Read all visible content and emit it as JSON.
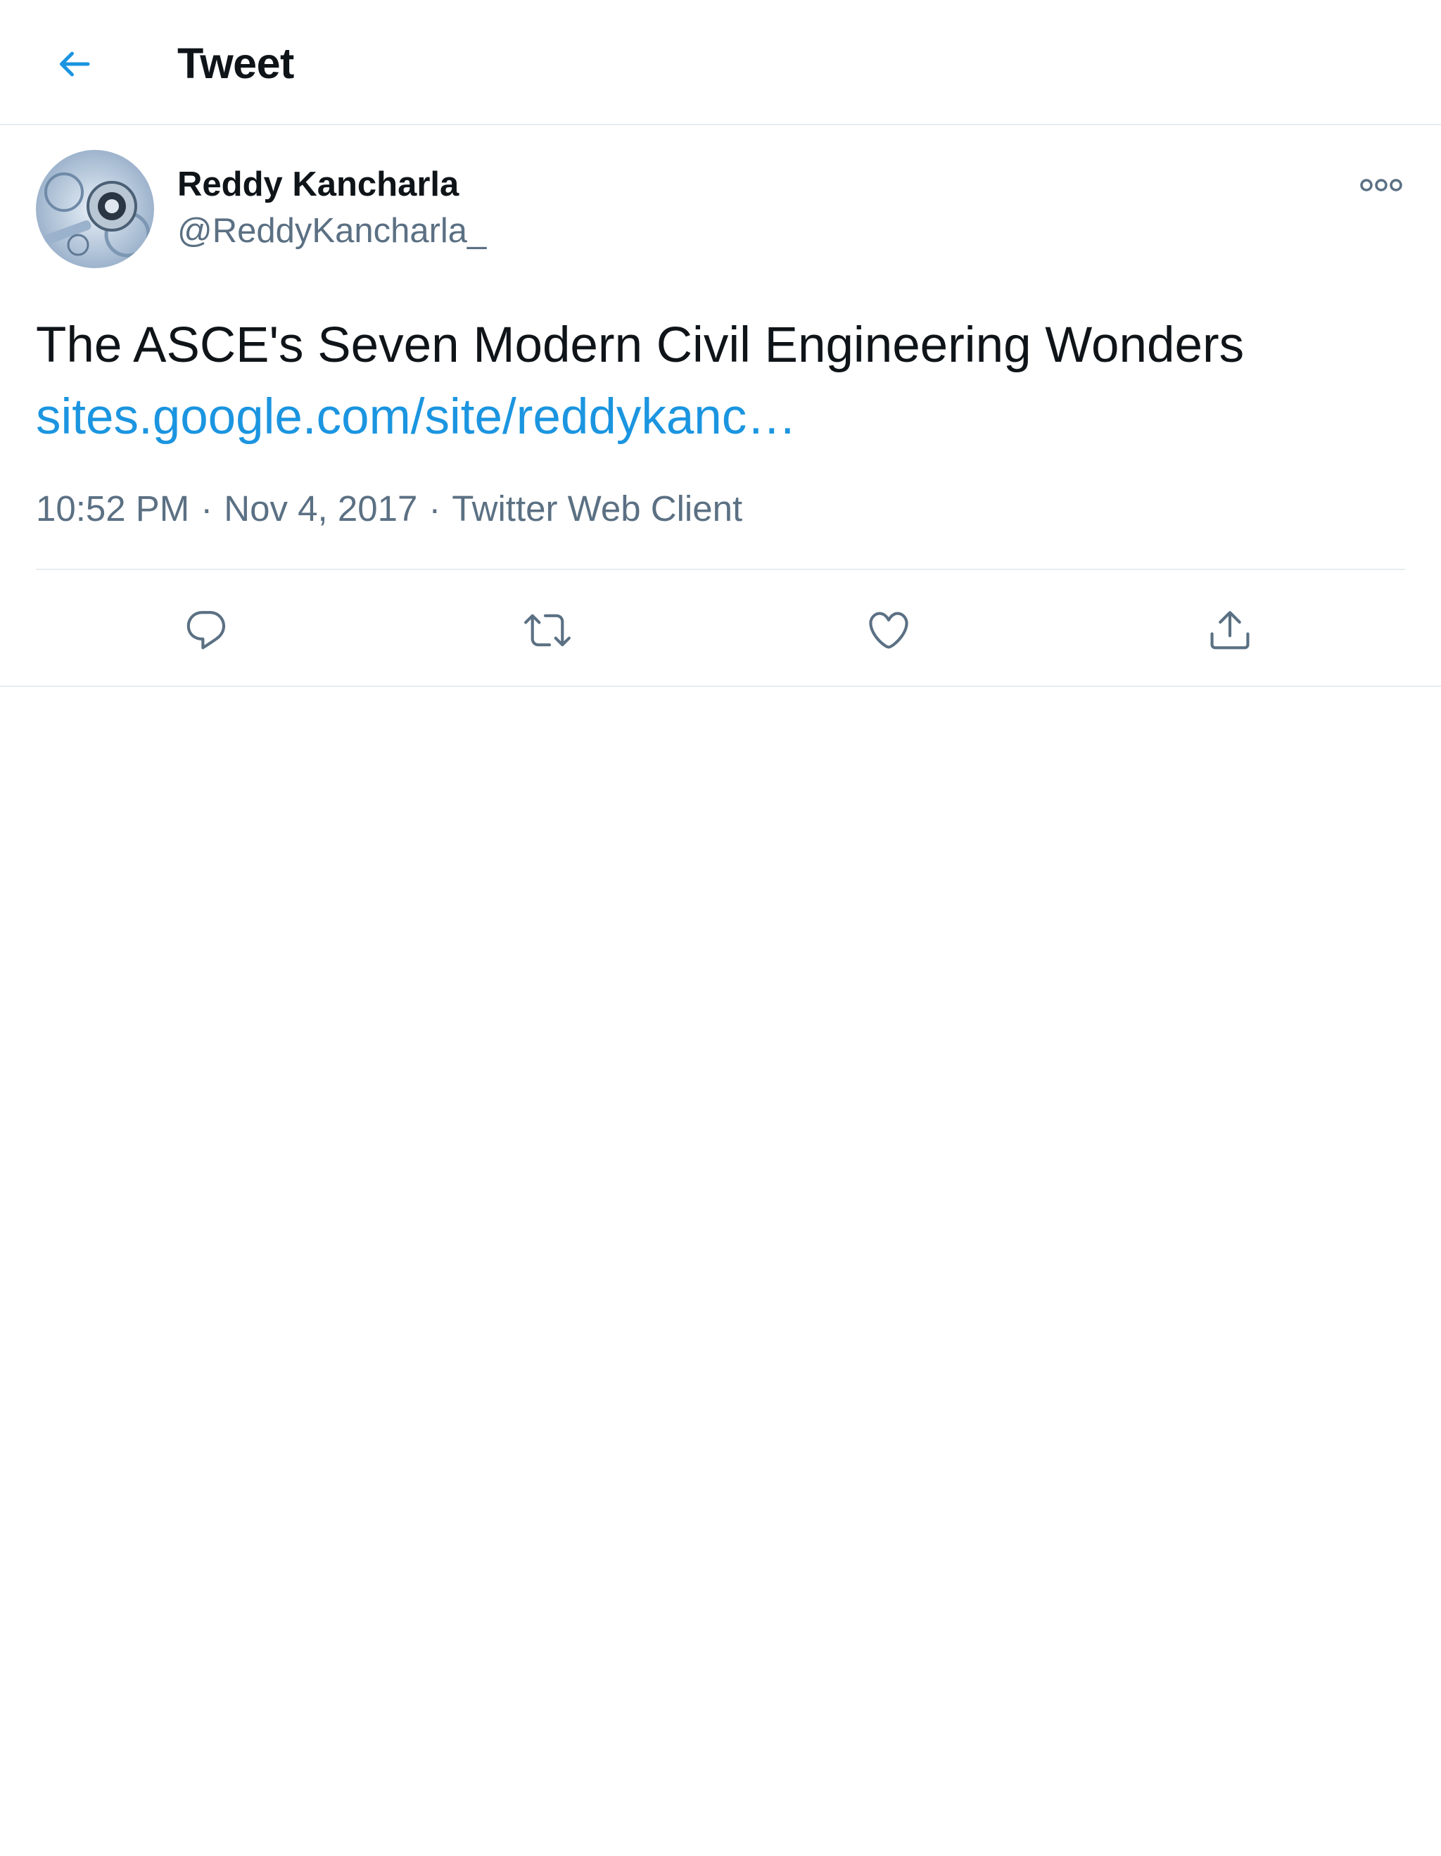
{
  "header": {
    "title": "Tweet",
    "back_icon": "arrow-left-icon"
  },
  "tweet": {
    "author": {
      "name": "Reddy Kancharla",
      "handle": "@ReddyKancharla_"
    },
    "text": "The ASCE's Seven Modern Civil Engineering Wonders",
    "link_text": "sites.google.com/site/reddykanc…",
    "time": "10:52 PM",
    "date": "Nov 4, 2017",
    "separator": "·",
    "source": "Twitter Web Client",
    "actions": [
      "reply-icon",
      "retweet-icon",
      "like-icon",
      "share-icon"
    ]
  },
  "colors": {
    "accent": "#1b95e0",
    "text_primary": "#0f1419",
    "text_secondary": "#5b7083",
    "border": "#e6ecf0"
  }
}
